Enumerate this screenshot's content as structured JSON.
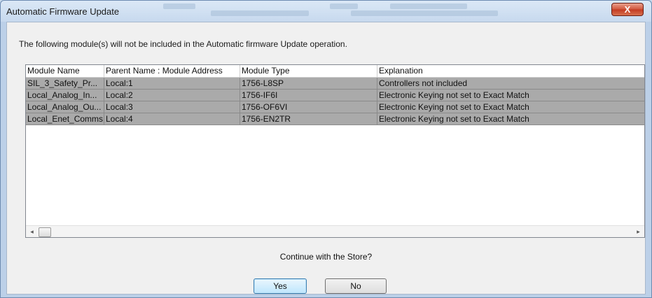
{
  "window": {
    "title": "Automatic Firmware Update",
    "close_label": "X"
  },
  "message": "The following module(s) will not be included in the Automatic firmware Update operation.",
  "table": {
    "headers": [
      "Module Name",
      "Parent Name : Module Address",
      "Module Type",
      "Explanation"
    ],
    "rows": [
      [
        "SIL_3_Safety_Pr...",
        "Local:1",
        "1756-L8SP",
        "Controllers not included"
      ],
      [
        "Local_Analog_In...",
        "Local:2",
        "1756-IF6I",
        "Electronic Keying not set to Exact Match"
      ],
      [
        "Local_Analog_Ou...",
        "Local:3",
        "1756-OF6VI",
        "Electronic Keying not set to Exact Match"
      ],
      [
        "Local_Enet_Comms",
        "Local:4",
        "1756-EN2TR",
        "Electronic Keying not set to Exact Match"
      ]
    ]
  },
  "scrollbar": {
    "left_arrow": "◂",
    "right_arrow": "▸"
  },
  "question": "Continue with the Store?",
  "buttons": {
    "yes": "Yes",
    "no": "No"
  }
}
